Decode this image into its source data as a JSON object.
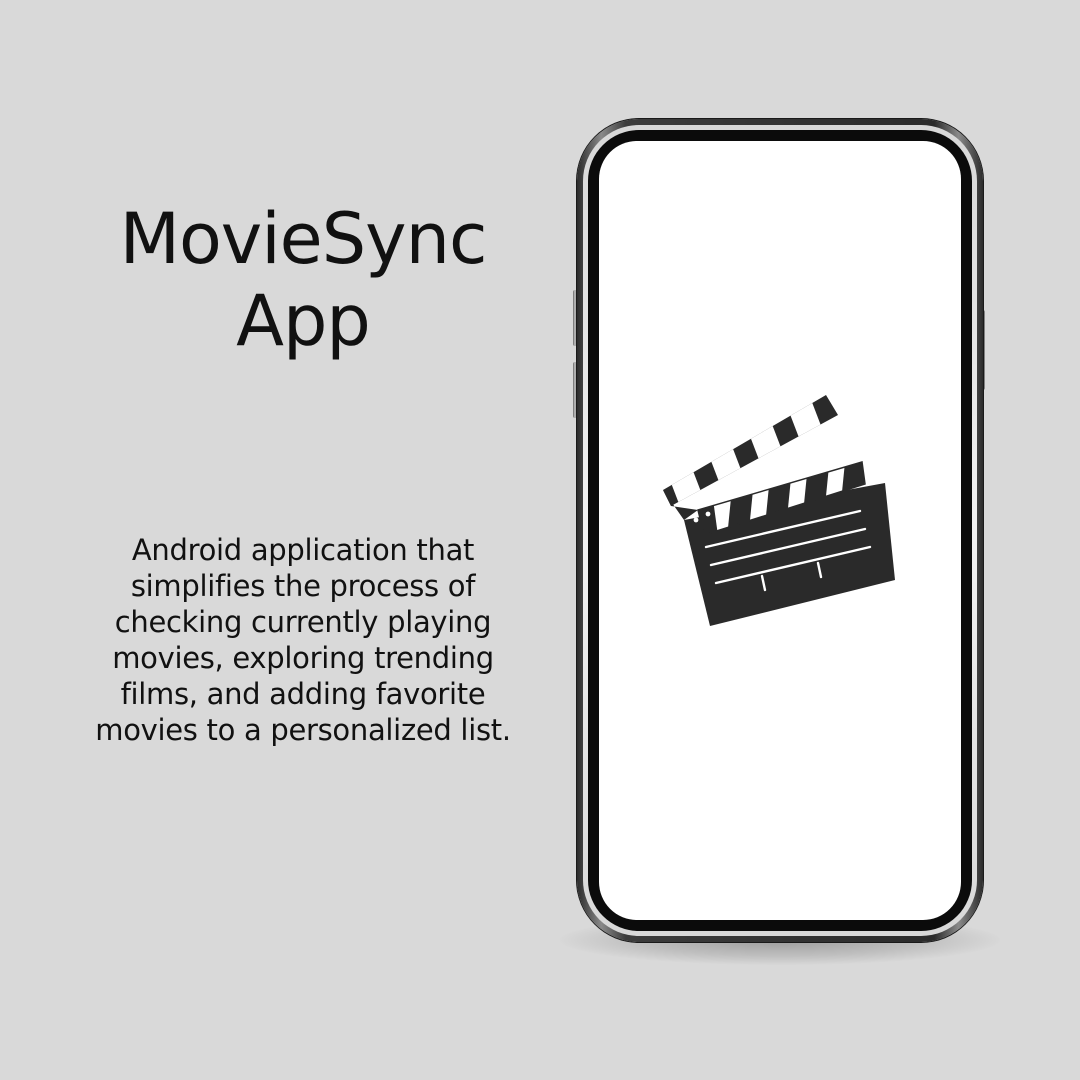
{
  "title": {
    "line1": "MovieSync",
    "line2": "App"
  },
  "description": "Android application that simplifies the process of checking currently playing movies, exploring trending films, and adding favorite movies to a personalized list.",
  "phone": {
    "screen_icon": "clapperboard-icon"
  },
  "colors": {
    "background": "#d9d9d9",
    "text": "#111111",
    "screen": "#ffffff",
    "clapper": "#2a2a2a"
  }
}
